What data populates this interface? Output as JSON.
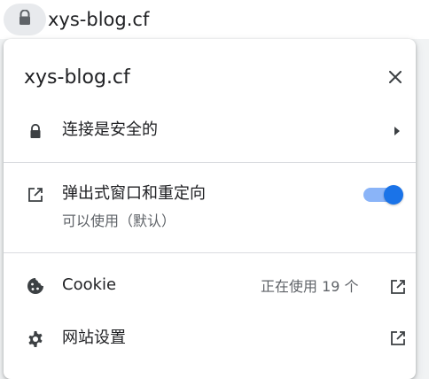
{
  "omnibox": {
    "url": "xys-blog.cf",
    "lock_icon": "lock-icon"
  },
  "popup": {
    "title": "xys-blog.cf",
    "close_icon": "close-icon",
    "connection": {
      "label": "连接是安全的",
      "icon": "lock-icon",
      "chevron_icon": "chevron-right-icon"
    },
    "popups": {
      "label": "弹出式窗口和重定向",
      "sublabel": "可以使用（默认）",
      "icon": "open-in-new-icon",
      "toggle_on": true
    },
    "cookie": {
      "label": "Cookie",
      "count_text": "正在使用 19 个",
      "icon": "cookie-icon",
      "link_icon": "open-in-new-icon"
    },
    "site_settings": {
      "label": "网站设置",
      "icon": "gear-icon",
      "link_icon": "open-in-new-icon"
    }
  },
  "colors": {
    "accent": "#1a73e8",
    "toggle_track": "#8ab4f8",
    "text_primary": "#202124",
    "text_secondary": "#5f6368",
    "divider": "#dadce0"
  }
}
